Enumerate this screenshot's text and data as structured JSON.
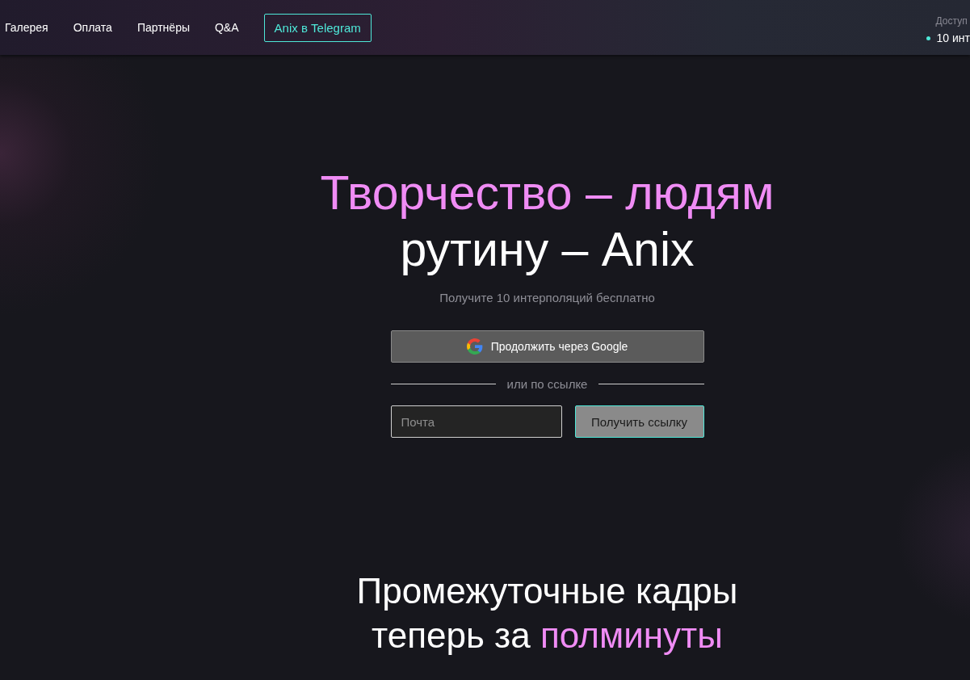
{
  "nav": {
    "links": [
      "Галерея",
      "Оплата",
      "Партнёры",
      "Q&A"
    ],
    "telegram_button": "Anix в Telegram",
    "balance": {
      "label": "Доступ",
      "value": "10 инт",
      "color": "#4ee8d8"
    }
  },
  "hero": {
    "title_line_1": "Творчество – людям",
    "title_line_2": "рутину – Anix",
    "subtitle": "Получите 10 интерполяций бесплатно",
    "google_button": "Продолжить через Google",
    "divider": "или по ссылке",
    "email_field": {
      "placeholder": "Почта"
    },
    "link_button": "Получить ссылку"
  },
  "section": {
    "heading_line_1": "Промежуточные кадры",
    "heading_line_2": "теперь за **полминуты**"
  }
}
